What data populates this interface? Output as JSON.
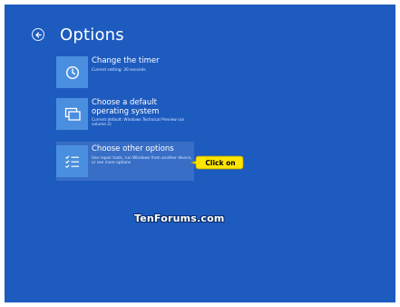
{
  "header": {
    "title": "Options",
    "back_icon": "back-arrow-icon"
  },
  "options": [
    {
      "title": "Change the timer",
      "subtitle": "Current setting: 30 seconds",
      "icon": "clock-icon"
    },
    {
      "title": "Choose a default operating system",
      "subtitle": "Current default: Windows Technical Preview (on volume 2)",
      "icon": "windows-stack-icon"
    },
    {
      "title": "Choose other options",
      "subtitle": "Use repair tools, run Windows from another device, or see more options",
      "icon": "checklist-icon"
    }
  ],
  "callout": {
    "label": "Click on"
  },
  "watermark": {
    "text": "TenForums.com"
  },
  "colors": {
    "background": "#1d5bbf",
    "tile": "#4a8fdf",
    "callout": "#ffe600"
  }
}
